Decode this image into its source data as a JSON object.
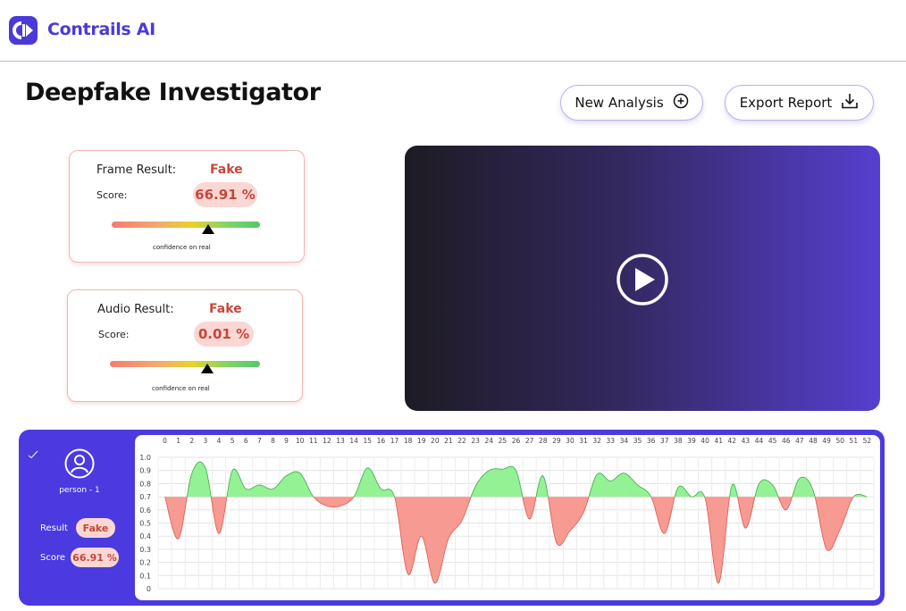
{
  "app": {
    "name": "Contrails AI"
  },
  "header": {
    "title": "Deepfake Investigator"
  },
  "actions": {
    "new_analysis": "New Analysis",
    "export_report": "Export Report"
  },
  "frame_result": {
    "label": "Frame Result:",
    "verdict": "Fake",
    "score_label": "Score:",
    "score": "66.91 %",
    "confidence_label": "confidence on real",
    "confidence_level": 0.65
  },
  "audio_result": {
    "label": "Audio Result:",
    "verdict": "Fake",
    "score_label": "Score:",
    "score": "0.01 %",
    "confidence_label": "confidence on real",
    "confidence_level": 0.65
  },
  "person": {
    "name": "person - 1",
    "result_label": "Result",
    "result": "Fake",
    "score_label": "Score",
    "score": "66.91 %"
  },
  "colors": {
    "accent": "#4a3ae0",
    "fake": "#c8453a",
    "fake_fill": "#f7958c",
    "real_fill": "#8ef08e"
  },
  "chart_data": {
    "type": "area",
    "threshold": 0.7,
    "ylim": [
      0,
      1.0
    ],
    "y_ticks": [
      "1.0",
      "0.9",
      "0.8",
      "0.7",
      "0.6",
      "0.5",
      "0.4",
      "0.3",
      "0.2",
      "0.1",
      "0"
    ],
    "x_ticks": [
      "0",
      "1",
      "2",
      "3",
      "4",
      "5",
      "6",
      "7",
      "8",
      "9",
      "10",
      "11",
      "12",
      "13",
      "14",
      "15",
      "16",
      "17",
      "18",
      "19",
      "20",
      "21",
      "22",
      "23",
      "24",
      "25",
      "26",
      "27",
      "28",
      "29",
      "30",
      "31",
      "32",
      "33",
      "34",
      "35",
      "36",
      "37",
      "38",
      "39",
      "40",
      "41",
      "42",
      "43",
      "44",
      "45",
      "46",
      "47",
      "48",
      "49",
      "50",
      "51",
      "52"
    ],
    "values": [
      0.7,
      0.38,
      0.88,
      0.92,
      0.42,
      0.9,
      0.76,
      0.79,
      0.76,
      0.86,
      0.88,
      0.7,
      0.63,
      0.63,
      0.7,
      0.92,
      0.76,
      0.7,
      0.11,
      0.4,
      0.04,
      0.38,
      0.52,
      0.78,
      0.9,
      0.91,
      0.9,
      0.53,
      0.86,
      0.35,
      0.44,
      0.58,
      0.87,
      0.82,
      0.88,
      0.79,
      0.7,
      0.42,
      0.77,
      0.7,
      0.69,
      0.04,
      0.79,
      0.46,
      0.8,
      0.79,
      0.6,
      0.84,
      0.75,
      0.3,
      0.45,
      0.7,
      0.7
    ]
  }
}
